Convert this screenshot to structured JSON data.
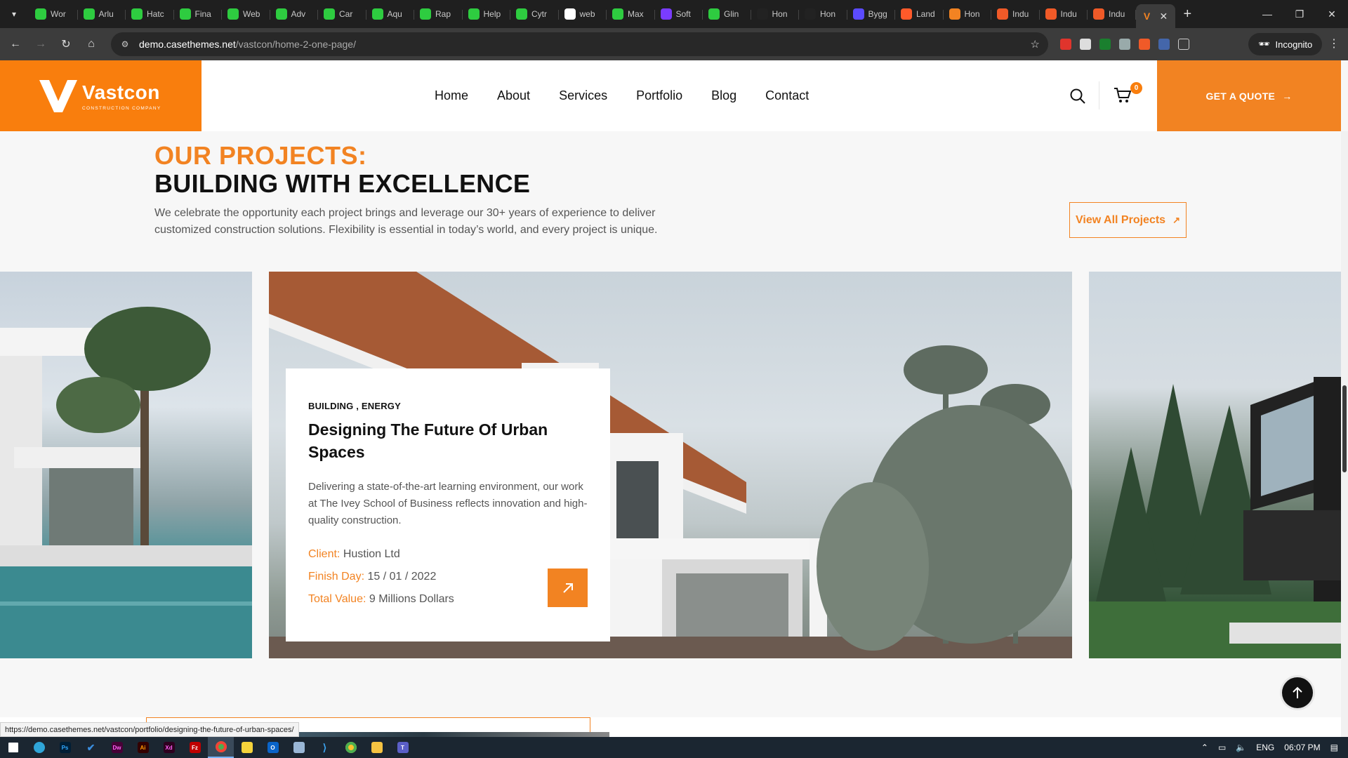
{
  "browser": {
    "tabs": [
      {
        "label": "Wor",
        "color": "#2ecc40"
      },
      {
        "label": "Arlu",
        "color": "#2ecc40"
      },
      {
        "label": "Hatc",
        "color": "#2ecc40"
      },
      {
        "label": "Fina",
        "color": "#2ecc40"
      },
      {
        "label": "Web",
        "color": "#2ecc40"
      },
      {
        "label": "Adv",
        "color": "#2ecc40"
      },
      {
        "label": "Car",
        "color": "#2ecc40"
      },
      {
        "label": "Aqu",
        "color": "#2ecc40"
      },
      {
        "label": "Rap",
        "color": "#2ecc40"
      },
      {
        "label": "Help",
        "color": "#2ecc40"
      },
      {
        "label": "Cytr",
        "color": "#2ecc40"
      },
      {
        "label": "web",
        "color": "#ffffff"
      },
      {
        "label": "Max",
        "color": "#2ecc40"
      },
      {
        "label": "Soft",
        "color": "#7a3cff"
      },
      {
        "label": "Glin",
        "color": "#2ecc40"
      },
      {
        "label": "Hon",
        "color": "#222222"
      },
      {
        "label": "Hon",
        "color": "#222222"
      },
      {
        "label": "Bygg",
        "color": "#5b4bff"
      },
      {
        "label": "Land",
        "color": "#ff5a2a"
      },
      {
        "label": "Hon",
        "color": "#f28322"
      },
      {
        "label": "Indu",
        "color": "#f05a28"
      },
      {
        "label": "Indu",
        "color": "#f05a28"
      },
      {
        "label": "Indu",
        "color": "#f05a28"
      }
    ],
    "active_tab_color": "#f28322",
    "url_host": "demo.casethemes.net",
    "url_path": "/vastcon/home-2-one-page/",
    "incognito_label": "Incognito",
    "status_url": "https://demo.casethemes.net/vastcon/portfolio/designing-the-future-of-urban-spaces/"
  },
  "header": {
    "logo_name": "Vastcon",
    "logo_tagline": "CONSTRUCTION COMPANY",
    "nav": [
      "Home",
      "About",
      "Services",
      "Portfolio",
      "Blog",
      "Contact"
    ],
    "cart_count": "0",
    "quote_label": "GET A QUOTE",
    "brand_color": "#f28322"
  },
  "projects": {
    "eyebrow": "OUR PROJECTS:",
    "title": "BUILDING WITH EXCELLENCE",
    "description": "We celebrate the opportunity each project brings and leverage our 30+ years of experience to deliver customized construction solutions. Flexibility is essential in today’s world, and every project is unique.",
    "view_all_label": "View All Projects",
    "card": {
      "categories": "BUILDING , ENERGY",
      "title": "Designing The Future Of Urban Spaces",
      "description": "Delivering a state-of-the-art learning environment, our work at The Ivey School of Business reflects innovation and high-quality construction.",
      "client_label": "Client:",
      "client_value": "Hustion Ltd",
      "finish_label": "Finish Day:",
      "finish_value": "15 / 01 / 2022",
      "total_label": "Total Value:",
      "total_value": "9 Millions Dollars"
    }
  },
  "taskbar": {
    "apps": [
      "win",
      "edge",
      "Ps",
      "todo",
      "Dw",
      "Ai",
      "Xd",
      "Fz",
      "chrome",
      "notes",
      "Outlook",
      "files",
      "vscode",
      "chrome",
      "explorer",
      "teams"
    ],
    "lang": "ENG",
    "time": "06:07 PM"
  }
}
